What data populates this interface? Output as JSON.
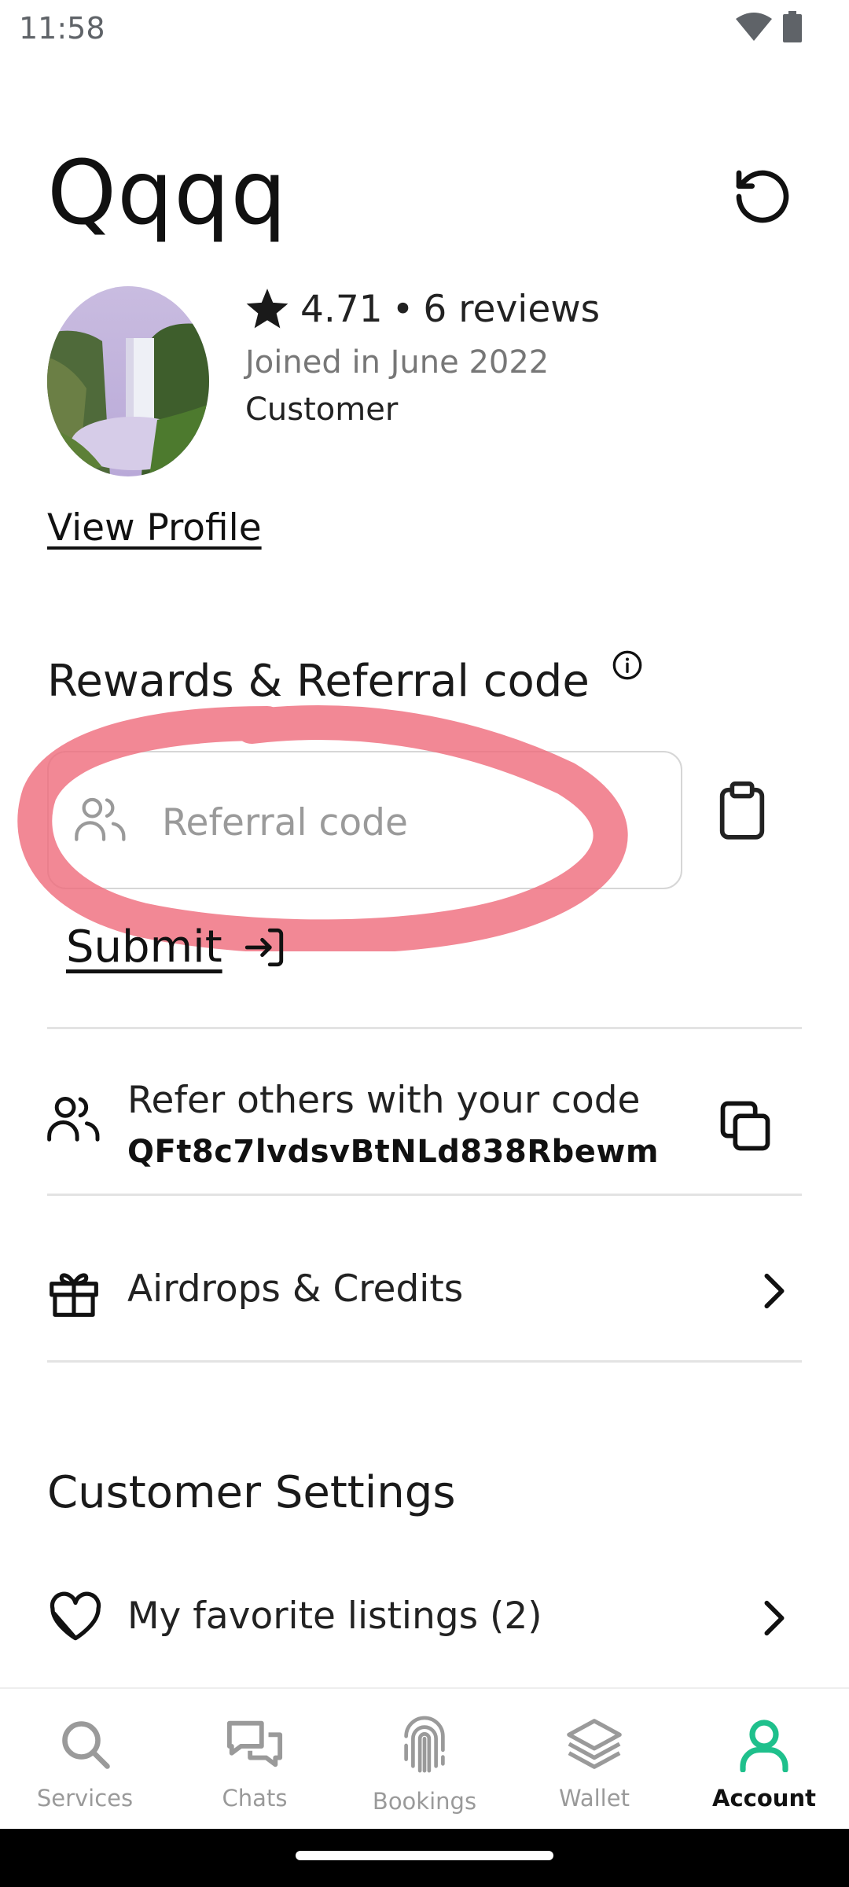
{
  "status_bar": {
    "time": "11:58"
  },
  "profile": {
    "name": "Qqqq",
    "rating": "4.71",
    "separator": "•",
    "reviews": "6 reviews",
    "joined": "Joined in June 2022",
    "role": "Customer",
    "view_profile_label": "View Profile"
  },
  "rewards": {
    "title": "Rewards & Referral code",
    "input_placeholder": "Referral code",
    "submit_label": "Submit",
    "refer_title": "Refer others with your code",
    "refer_code": "QFt8c7lvdsvBtNLd838Rbewm",
    "airdrops_label": "Airdrops & Credits"
  },
  "customer_settings": {
    "title": "Customer Settings",
    "favorites_label": "My favorite listings (2)"
  },
  "tabs": [
    {
      "label": "Services",
      "icon": "search-icon",
      "active": false
    },
    {
      "label": "Chats",
      "icon": "chat-icon",
      "active": false
    },
    {
      "label": "Bookings",
      "icon": "fingerprint-icon",
      "active": false
    },
    {
      "label": "Wallet",
      "icon": "layers-icon",
      "active": false
    },
    {
      "label": "Account",
      "icon": "user-icon",
      "active": true
    }
  ],
  "colors": {
    "accent": "#1fc08c",
    "highlight": "#ef6a7a",
    "inactive_tab": "#9a9a9a"
  }
}
